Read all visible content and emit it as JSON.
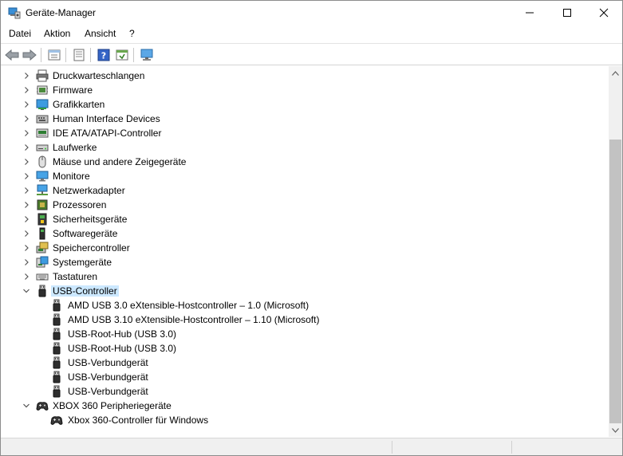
{
  "window": {
    "title": "Geräte-Manager"
  },
  "menu": [
    {
      "label": "Datei"
    },
    {
      "label": "Aktion"
    },
    {
      "label": "Ansicht"
    },
    {
      "label": "?"
    }
  ],
  "toolbar": {
    "buttons": [
      "back-arrow-icon",
      "forward-arrow-icon",
      "device-list-icon",
      "properties-icon",
      "help-icon",
      "update-driver-icon",
      "scan-hardware-icon"
    ]
  },
  "tree": {
    "categories": [
      {
        "label": "Druckwarteschlangen",
        "icon": "printer-queue-icon",
        "expanded": false
      },
      {
        "label": "Firmware",
        "icon": "firmware-icon",
        "expanded": false
      },
      {
        "label": "Grafikkarten",
        "icon": "display-adapter-icon",
        "expanded": false
      },
      {
        "label": "Human Interface Devices",
        "icon": "hid-icon",
        "expanded": false
      },
      {
        "label": "IDE ATA/ATAPI-Controller",
        "icon": "ide-controller-icon",
        "expanded": false
      },
      {
        "label": "Laufwerke",
        "icon": "disk-drive-icon",
        "expanded": false
      },
      {
        "label": "Mäuse und andere Zeigegeräte",
        "icon": "mouse-icon",
        "expanded": false
      },
      {
        "label": "Monitore",
        "icon": "monitor-icon",
        "expanded": false
      },
      {
        "label": "Netzwerkadapter",
        "icon": "network-adapter-icon",
        "expanded": false
      },
      {
        "label": "Prozessoren",
        "icon": "processor-icon",
        "expanded": false
      },
      {
        "label": "Sicherheitsgeräte",
        "icon": "security-device-icon",
        "expanded": false
      },
      {
        "label": "Softwaregeräte",
        "icon": "software-device-icon",
        "expanded": false
      },
      {
        "label": "Speichercontroller",
        "icon": "storage-controller-icon",
        "expanded": false
      },
      {
        "label": "Systemgeräte",
        "icon": "system-device-icon",
        "expanded": false
      },
      {
        "label": "Tastaturen",
        "icon": "keyboard-icon",
        "expanded": false
      },
      {
        "label": "USB-Controller",
        "icon": "usb-icon",
        "expanded": true,
        "selected": true,
        "children": [
          {
            "label": "AMD USB 3.0 eXtensible-Hostcontroller – 1.0 (Microsoft)",
            "icon": "usb-icon"
          },
          {
            "label": "AMD USB 3.10 eXtensible-Hostcontroller – 1.10 (Microsoft)",
            "icon": "usb-icon"
          },
          {
            "label": "USB-Root-Hub (USB 3.0)",
            "icon": "usb-icon"
          },
          {
            "label": "USB-Root-Hub (USB 3.0)",
            "icon": "usb-icon"
          },
          {
            "label": "USB-Verbundgerät",
            "icon": "usb-icon"
          },
          {
            "label": "USB-Verbundgerät",
            "icon": "usb-icon"
          },
          {
            "label": "USB-Verbundgerät",
            "icon": "usb-icon"
          }
        ]
      },
      {
        "label": "XBOX 360 Peripheriegeräte",
        "icon": "gamepad-icon",
        "expanded": true,
        "children": [
          {
            "label": "Xbox 360-Controller für Windows",
            "icon": "gamepad-icon"
          }
        ]
      }
    ]
  },
  "colors": {
    "selection": "#cce8ff",
    "scrollbar_thumb": "#c2c2c2",
    "chrome": "#f0f0f0"
  }
}
